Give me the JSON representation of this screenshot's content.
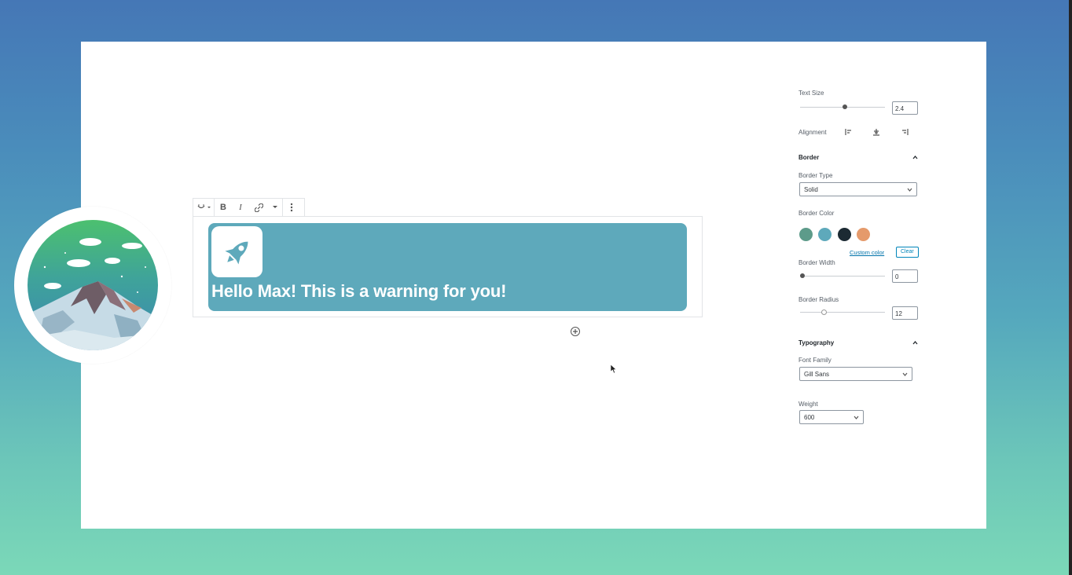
{
  "editor": {
    "notice": {
      "text": "Hello Max! This is a warning for you!",
      "background": "#5ea9bb",
      "icon": "rocket-icon"
    },
    "toolbar": {
      "icon_picker": "icon-picker",
      "bold": "B",
      "italic": "I",
      "link": "link-icon",
      "more_rich": "chevron-down-icon",
      "more_options": "more-vertical-icon"
    },
    "add_block": "plus-circle-icon"
  },
  "sidebar": {
    "text_size": {
      "label": "Text Size",
      "value": "2.4",
      "level": 0.5
    },
    "alignment": {
      "label": "Alignment",
      "options": [
        "align-left-icon",
        "align-center-icon",
        "align-right-icon"
      ]
    },
    "border": {
      "heading": "Border",
      "type_label": "Border Type",
      "type_value": "Solid",
      "color_label": "Border Color",
      "colors": [
        "#5d9b8a",
        "#5ea9bb",
        "#1c2a33",
        "#e59a6b"
      ],
      "custom_color": "Custom color",
      "clear": "Clear",
      "width_label": "Border Width",
      "width_value": "0",
      "width_level": 0.0,
      "radius_label": "Border Radius",
      "radius_value": "12",
      "radius_level": 0.25
    },
    "typography": {
      "heading": "Typography",
      "font_label": "Font Family",
      "font_value": "Gill Sans",
      "weight_label": "Weight",
      "weight_value": "600"
    }
  }
}
